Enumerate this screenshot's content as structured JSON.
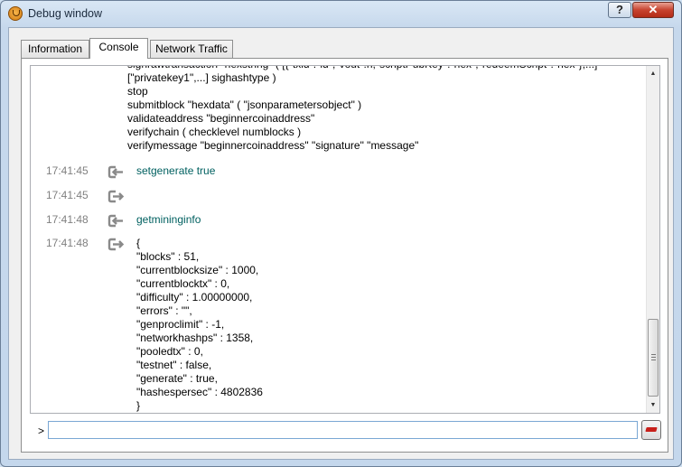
{
  "window": {
    "title": "Debug window",
    "help_label": "?",
    "close_label": "✕"
  },
  "tabs": [
    {
      "label": "Information",
      "active": false
    },
    {
      "label": "Console",
      "active": true
    },
    {
      "label": "Network Traffic",
      "active": false
    }
  ],
  "console": {
    "help_lines": [
      "signrawtransaction \"hexstring\" ( [{\"txid\":\"id\",\"vout\":n,\"scriptPubKey\":\"hex\",\"redeemScript\":\"hex\"},...]",
      "[\"privatekey1\",...] sighashtype )",
      "stop",
      "submitblock \"hexdata\" ( \"jsonparametersobject\" )",
      "validateaddress \"beginnercoinaddress\"",
      "verifychain ( checklevel numblocks )",
      "verifymessage \"beginnercoinaddress\" \"signature\" \"message\""
    ],
    "entries": [
      {
        "time": "17:41:45",
        "kind": "request",
        "icon": "arrow-in-icon",
        "lines": [
          "setgenerate true"
        ]
      },
      {
        "time": "17:41:45",
        "kind": "reply",
        "icon": "arrow-out-icon",
        "lines": [
          ""
        ]
      },
      {
        "time": "17:41:48",
        "kind": "request",
        "icon": "arrow-in-icon",
        "lines": [
          "getmininginfo"
        ]
      },
      {
        "time": "17:41:48",
        "kind": "reply",
        "icon": "arrow-out-icon",
        "lines": [
          "{",
          "\"blocks\" : 51,",
          "\"currentblocksize\" : 1000,",
          "\"currentblocktx\" : 0,",
          "\"difficulty\" : 1.00000000,",
          "\"errors\" : \"\",",
          "\"genproclimit\" : -1,",
          "\"networkhashps\" : 1358,",
          "\"pooledtx\" : 0,",
          "\"testnet\" : false,",
          "\"generate\" : true,",
          "\"hashespersec\" : 4802836",
          "}"
        ]
      }
    ]
  },
  "input": {
    "prompt": ">",
    "value": "",
    "placeholder": ""
  },
  "colors": {
    "command_text": "#006060",
    "timestamp": "#808080"
  }
}
